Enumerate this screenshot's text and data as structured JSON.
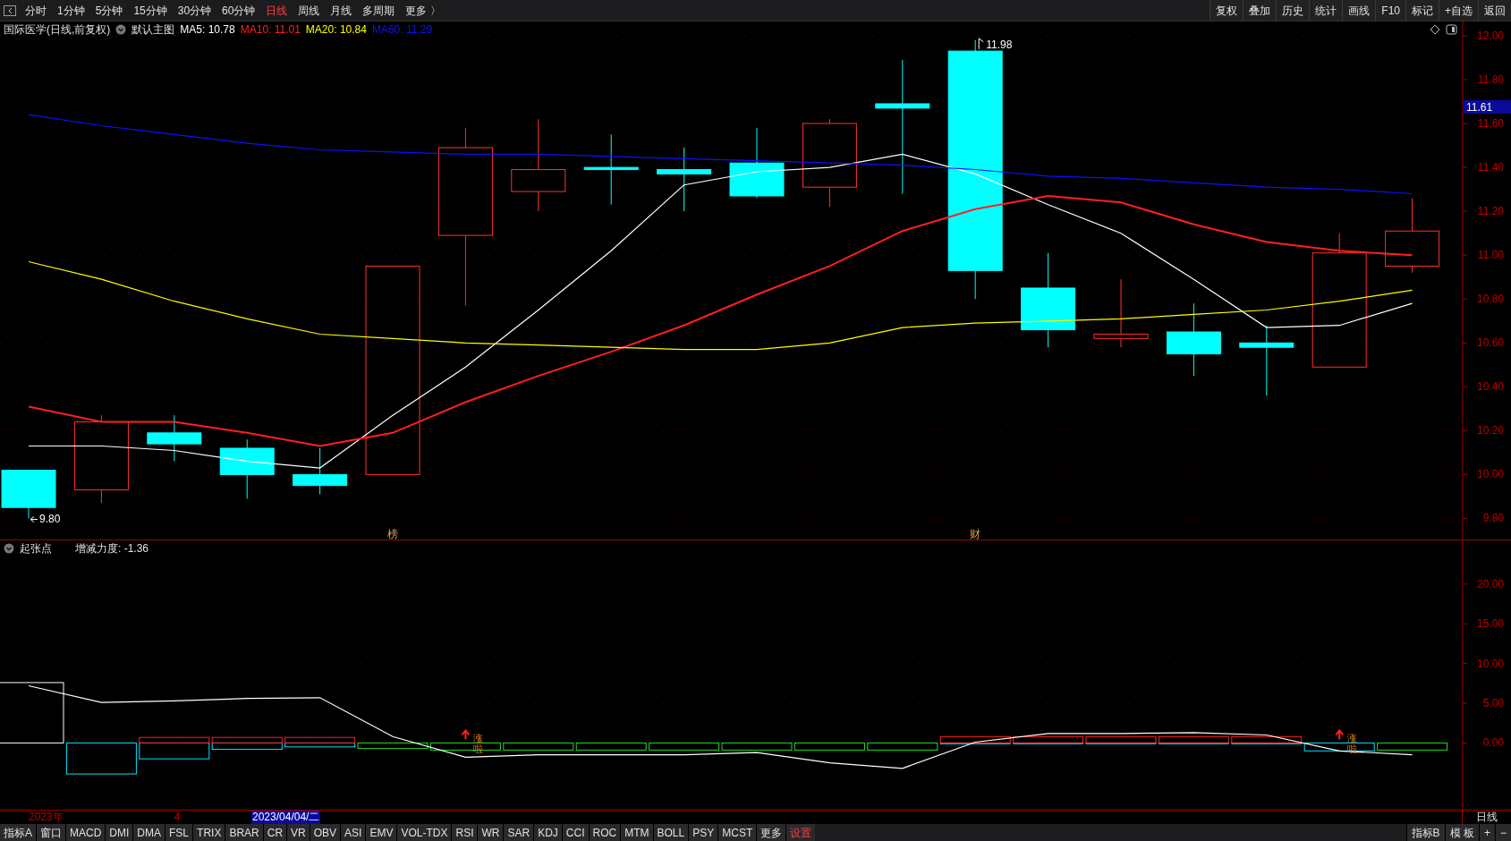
{
  "toolbar": {
    "periods": [
      {
        "label": "分时",
        "selected": false
      },
      {
        "label": "1分钟",
        "selected": false
      },
      {
        "label": "5分钟",
        "selected": false
      },
      {
        "label": "15分钟",
        "selected": false
      },
      {
        "label": "30分钟",
        "selected": false
      },
      {
        "label": "60分钟",
        "selected": false
      },
      {
        "label": "日线",
        "selected": true
      },
      {
        "label": "周线",
        "selected": false
      },
      {
        "label": "月线",
        "selected": false
      },
      {
        "label": "多周期",
        "selected": false
      },
      {
        "label": "更多 〉",
        "selected": false
      }
    ],
    "actions": [
      "复权",
      "叠加",
      "历史",
      "统计",
      "画线",
      "F10",
      "标记",
      "+自选",
      "返回"
    ]
  },
  "main_chart": {
    "title": "国际医学(日线,前复权)",
    "template": "默认主图",
    "legend": [
      {
        "label": "MA5: 10.78",
        "color": "#ffffff"
      },
      {
        "label": "MA10: 11.01",
        "color": "#ff2020"
      },
      {
        "label": "MA20: 10.84",
        "color": "#ffff00"
      },
      {
        "label": "MA60: 11.29",
        "color": "#1010ff"
      }
    ],
    "price_tag": "11.61",
    "chart_data": {
      "type": "line",
      "grid": true,
      "ylim": [
        9.7,
        12.065
      ],
      "yticks": [
        {
          "value": 9.8,
          "label": "9.80"
        },
        {
          "value": 10.0,
          "label": "10.00"
        },
        {
          "value": 10.2,
          "label": "10.20"
        },
        {
          "value": 10.4,
          "label": "10.40"
        },
        {
          "value": 10.6,
          "label": "10.60"
        },
        {
          "value": 10.8,
          "label": "10.80"
        },
        {
          "value": 11.0,
          "label": "11.00"
        },
        {
          "value": 11.2,
          "label": "11.20"
        },
        {
          "value": 11.4,
          "label": "11.40"
        },
        {
          "value": 11.6,
          "label": "11.60"
        },
        {
          "value": 11.8,
          "label": "11.80"
        },
        {
          "value": 12.0,
          "label": "12.00"
        }
      ],
      "series": [
        {
          "color": "#ffffff",
          "values": [
            10.13,
            10.13,
            10.11,
            10.06,
            10.03,
            10.27,
            10.49,
            10.75,
            11.02,
            11.32,
            11.38,
            11.4,
            11.46,
            11.37,
            11.23,
            11.1,
            10.89,
            10.67,
            10.68,
            10.78
          ]
        },
        {
          "color": "#ff2020",
          "values": [
            10.31,
            10.24,
            10.24,
            10.19,
            10.13,
            10.19,
            10.33,
            10.45,
            10.56,
            10.68,
            10.82,
            10.95,
            11.11,
            11.21,
            11.27,
            11.24,
            11.14,
            11.06,
            11.02,
            11.0
          ]
        },
        {
          "color": "#ffff00",
          "values": [
            10.97,
            10.89,
            10.79,
            10.71,
            10.64,
            10.62,
            10.6,
            10.59,
            10.58,
            10.57,
            10.57,
            10.6,
            10.67,
            10.69,
            10.7,
            10.71,
            10.73,
            10.75,
            10.79,
            10.84
          ]
        },
        {
          "color": "#1010ff",
          "values": [
            11.64,
            11.59,
            11.55,
            11.51,
            11.48,
            11.47,
            11.46,
            11.46,
            11.45,
            11.44,
            11.43,
            11.42,
            11.41,
            11.39,
            11.36,
            11.35,
            11.33,
            11.31,
            11.3,
            11.28
          ]
        }
      ],
      "annotations": [
        "9.80",
        "11.98",
        "榜",
        "财"
      ]
    }
  },
  "indicator": {
    "name": "起张点",
    "reading": "增减力度: -1.36",
    "chart_data": {
      "type": "bar",
      "grid": true,
      "ylim": [
        -8.4,
        25.5
      ],
      "yticks": [
        {
          "value": 0,
          "label": "0.00"
        },
        {
          "value": 5,
          "label": "5.00"
        },
        {
          "value": 10,
          "label": "10.00"
        },
        {
          "value": 15,
          "label": "15.00"
        },
        {
          "value": 20,
          "label": "20.00"
        }
      ],
      "series": [
        {
          "type": "bar",
          "color": "#ffffff",
          "values": [
            7.6,
            null,
            null,
            null,
            null,
            null,
            null,
            null,
            null,
            null,
            null,
            null,
            null,
            null,
            null,
            null,
            null,
            null,
            null,
            null
          ]
        },
        {
          "type": "bar",
          "color": "#00e5ff",
          "values": [
            null,
            -3.9,
            -2.0,
            -0.8,
            -0.5,
            null,
            null,
            null,
            null,
            null,
            null,
            null,
            null,
            -0.1,
            -0.1,
            -0.1,
            -0.1,
            -0.1,
            -1.0,
            null
          ]
        },
        {
          "type": "bar",
          "color": "#ff2020",
          "values": [
            null,
            null,
            0.7,
            0.7,
            0.7,
            null,
            null,
            null,
            null,
            null,
            null,
            null,
            null,
            0.8,
            0.8,
            0.8,
            0.8,
            0.8,
            null,
            null
          ]
        },
        {
          "type": "bar",
          "color": "#20e020",
          "values": [
            null,
            null,
            null,
            null,
            null,
            -0.7,
            -0.9,
            -0.9,
            -0.9,
            -0.9,
            -0.9,
            -0.9,
            -0.9,
            null,
            null,
            null,
            null,
            null,
            null,
            -0.9
          ]
        },
        {
          "type": "line",
          "color": "#ffffff",
          "values": [
            7.2,
            5.1,
            5.3,
            5.6,
            5.7,
            0.8,
            -1.8,
            -1.5,
            -1.5,
            -1.5,
            -1.2,
            -2.5,
            -3.2,
            0.1,
            1.2,
            1.2,
            1.3,
            1.0,
            -1.0,
            -1.5
          ]
        }
      ],
      "annotations": [
        "涨啦",
        "涨啦"
      ]
    }
  },
  "date_row": {
    "labels": [
      "2023年",
      "4"
    ],
    "cursor_date": "2023/04/04/二",
    "period": "日线"
  },
  "bottom_bar": {
    "indicators": [
      "指标A",
      "窗口",
      "MACD",
      "DMI",
      "DMA",
      "FSL",
      "TRIX",
      "BRAR",
      "CR",
      "VR",
      "OBV",
      "ASI",
      "EMV",
      "VOL-TDX",
      "RSI",
      "WR",
      "SAR",
      "KDJ",
      "CCI",
      "ROC",
      "MTM",
      "BOLL",
      "PSY",
      "MCST",
      "更多"
    ],
    "settings": "设置",
    "right": [
      "指标B",
      "模 板",
      "+",
      "−"
    ]
  }
}
